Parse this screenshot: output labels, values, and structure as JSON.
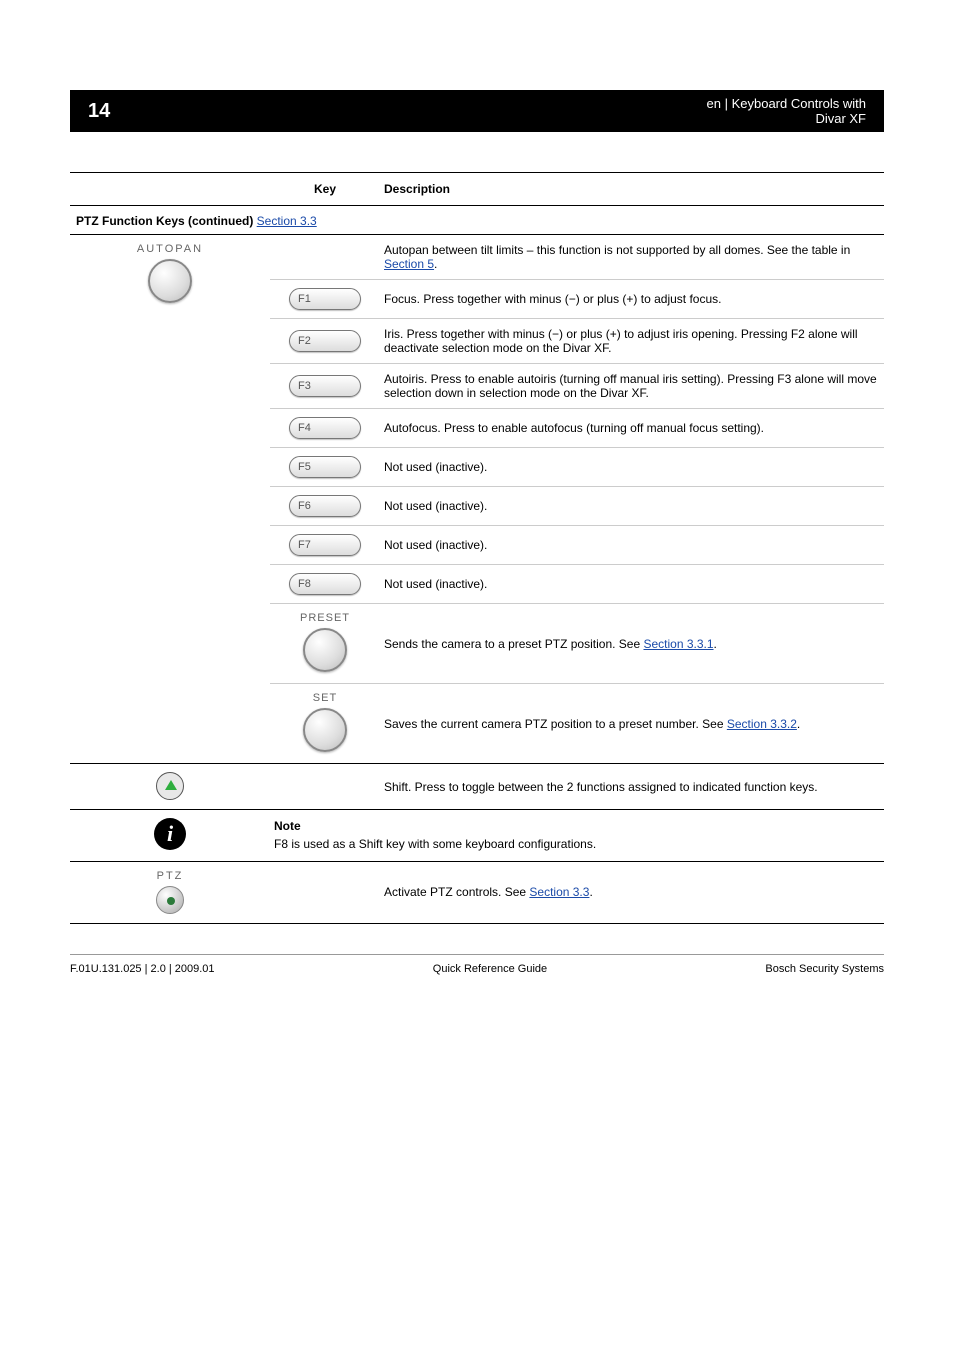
{
  "header": {
    "left": "14",
    "right_line1": "en | Keyboard Controls with",
    "right_line2": "Divar XF"
  },
  "table": {
    "col_headers": {
      "c1": "",
      "c2": "Key",
      "c3": "Description"
    },
    "section_ptz_cont": {
      "title": "PTZ Function Keys (continued)",
      "link": "Section 3.3"
    },
    "autopan": {
      "label": "AUTOPAN",
      "row3": {
        "desc_pre": "Autopan between tilt limits – this function is not supported by all domes. See the table in",
        "link": " Section 5"
      }
    },
    "fkeys": {
      "f1": {
        "label": "F1",
        "desc": "Focus. Press together with minus (−) or plus (+) to adjust focus."
      },
      "f2": {
        "label": "F2",
        "desc": "Iris. Press together with minus (−) or plus (+) to adjust iris opening. Pressing F2 alone will deactivate selection mode on the Divar XF."
      },
      "f3": {
        "label": "F3",
        "desc": "Autoiris. Press to enable autoiris (turning off manual iris setting). Pressing F3 alone will move selection down in selection mode on the Divar XF."
      },
      "f4": {
        "label": "F4",
        "desc": "Autofocus. Press to enable autofocus (turning off manual focus setting)."
      },
      "f5": {
        "label": "F5",
        "desc": "Not used (inactive)."
      },
      "f6": {
        "label": "F6",
        "desc": "Not used (inactive)."
      },
      "f7": {
        "label": "F7",
        "desc": "Not used (inactive)."
      },
      "f8": {
        "label": "F8",
        "desc": "Not used (inactive)."
      }
    },
    "preset": {
      "label": "PRESET",
      "desc_pre": "Sends the camera to a preset PTZ position. See ",
      "link": "Section 3.3.1",
      "desc_post": "."
    },
    "set": {
      "label": "SET",
      "desc_pre": "Saves the current camera PTZ position to a preset number. See ",
      "link": "Section 3.3.2",
      "desc_post": "."
    },
    "shift": {
      "desc": "Shift. Press to toggle between the 2 functions assigned to indicated function keys."
    },
    "note": {
      "heading": "Note",
      "text": "F8 is used as a Shift key with some keyboard configurations."
    },
    "ptz": {
      "label": "PTZ",
      "desc_pre": "Activate PTZ controls. See ",
      "link": "Section 3.3",
      "desc_post": "."
    }
  },
  "footer": {
    "left": "F.01U.131.025 | 2.0 | 2009.01",
    "center": "Quick Reference Guide",
    "right": "Bosch Security Systems"
  }
}
